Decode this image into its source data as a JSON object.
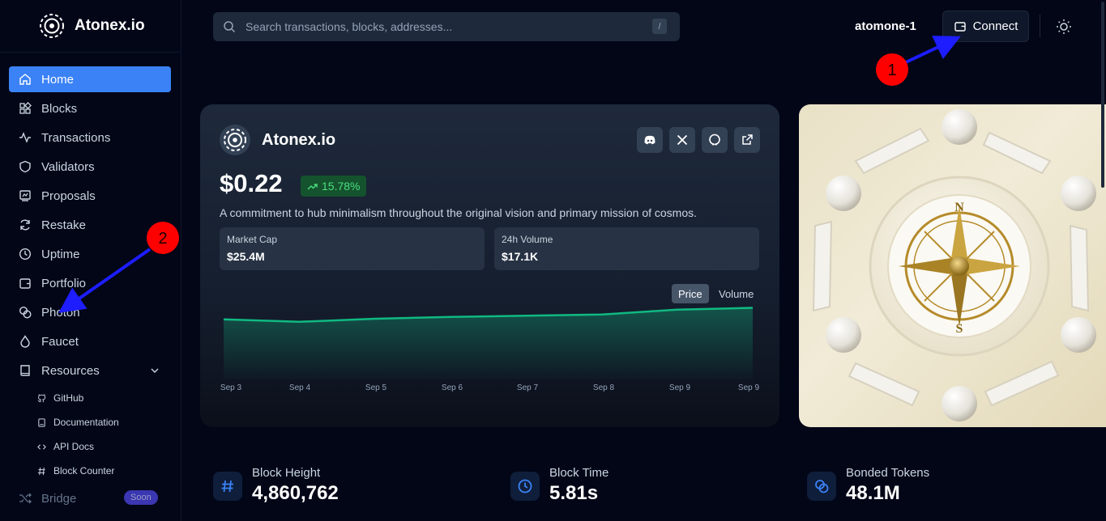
{
  "brand": {
    "name": "Atonex.io"
  },
  "nav": {
    "items": [
      {
        "label": "Home",
        "icon": "home-icon"
      },
      {
        "label": "Blocks",
        "icon": "blocks-icon"
      },
      {
        "label": "Transactions",
        "icon": "activity-icon"
      },
      {
        "label": "Validators",
        "icon": "shield-icon"
      },
      {
        "label": "Proposals",
        "icon": "proposal-icon"
      },
      {
        "label": "Restake",
        "icon": "refresh-icon"
      },
      {
        "label": "Uptime",
        "icon": "clock-icon"
      },
      {
        "label": "Portfolio",
        "icon": "wallet-icon"
      },
      {
        "label": "Photon",
        "icon": "coins-icon"
      },
      {
        "label": "Faucet",
        "icon": "droplet-icon"
      },
      {
        "label": "Resources",
        "icon": "book-icon"
      }
    ],
    "resources": [
      {
        "label": "GitHub",
        "icon": "github-icon"
      },
      {
        "label": "Documentation",
        "icon": "document-icon"
      },
      {
        "label": "API Docs",
        "icon": "code-icon"
      },
      {
        "label": "Block Counter",
        "icon": "hash-icon"
      }
    ],
    "bridge": {
      "label": "Bridge",
      "badge": "Soon"
    }
  },
  "search": {
    "placeholder": "Search transactions, blocks, addresses...",
    "shortcut": "/"
  },
  "header": {
    "chain": "atomone-1",
    "connect_label": "Connect"
  },
  "token": {
    "name": "Atonex.io",
    "price": "$0.22",
    "change": "15.78%",
    "description": "A commitment to hub minimalism throughout the original vision and primary mission of cosmos.",
    "market_cap_label": "Market Cap",
    "market_cap": "$25.4M",
    "volume_label": "24h Volume",
    "volume": "$17.1K",
    "toggle_price": "Price",
    "toggle_volume": "Volume"
  },
  "chart_data": {
    "type": "area",
    "categories": [
      "Sep 3",
      "Sep 4",
      "Sep 5",
      "Sep 6",
      "Sep 7",
      "Sep 8",
      "Sep 9",
      "Sep 9"
    ],
    "values": [
      0.199,
      0.195,
      0.2,
      0.203,
      0.205,
      0.207,
      0.215,
      0.218
    ],
    "ylim": [
      0.1,
      0.22
    ],
    "grid": false,
    "color": "#10b981"
  },
  "stats": [
    {
      "label": "Block Height",
      "value": "4,860,762",
      "icon": "hash-icon"
    },
    {
      "label": "Block Time",
      "value": "5.81s",
      "icon": "clock-icon"
    },
    {
      "label": "Bonded Tokens",
      "value": "48.1M",
      "icon": "coins-icon"
    }
  ],
  "annotations": [
    {
      "label": "1",
      "color": "#ff0000"
    },
    {
      "label": "2",
      "color": "#ff0000"
    }
  ],
  "colors": {
    "accent": "#3b82f6",
    "background": "#020617",
    "positive": "#4ade80"
  }
}
